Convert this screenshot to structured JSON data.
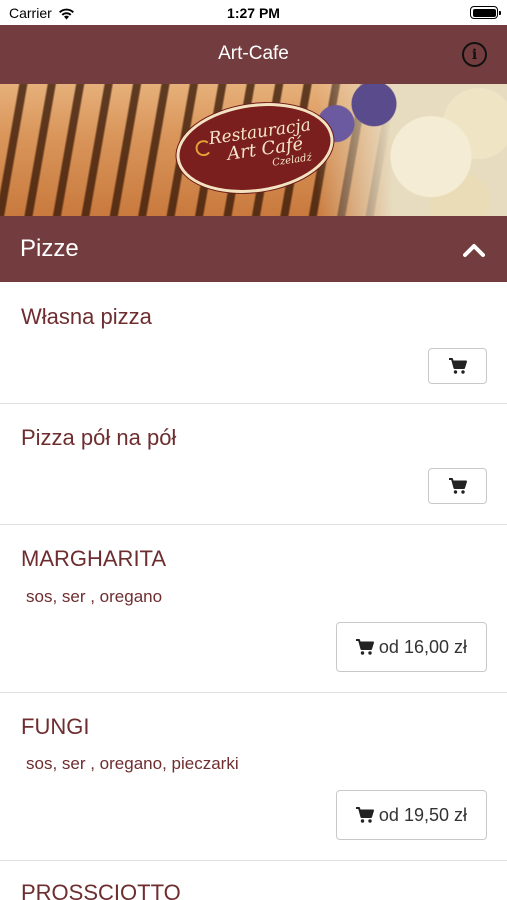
{
  "status_bar": {
    "carrier": "Carrier",
    "time": "1:27 PM"
  },
  "nav": {
    "title": "Art-Cafe",
    "info_icon": "info-icon"
  },
  "banner": {
    "logo_line1": "Restauracja",
    "logo_line2": "Art Café",
    "logo_line3": "Czeladź"
  },
  "section": {
    "title": "Pizze",
    "toggle_icon": "chevron-up-icon"
  },
  "items": [
    {
      "name": "Własna pizza",
      "desc": "",
      "price": ""
    },
    {
      "name": "Pizza pół na pół",
      "desc": "",
      "price": ""
    },
    {
      "name": "MARGHARITA",
      "desc": "sos, ser , oregano",
      "price": "od 16,00 zł"
    },
    {
      "name": "FUNGI",
      "desc": "sos, ser , oregano, pieczarki",
      "price": "od 19,50 zł"
    },
    {
      "name": "PROSSCIOTTO",
      "desc": "",
      "price": ""
    }
  ],
  "colors": {
    "brand": "#733d3f",
    "item_text": "#6e2d2f"
  }
}
